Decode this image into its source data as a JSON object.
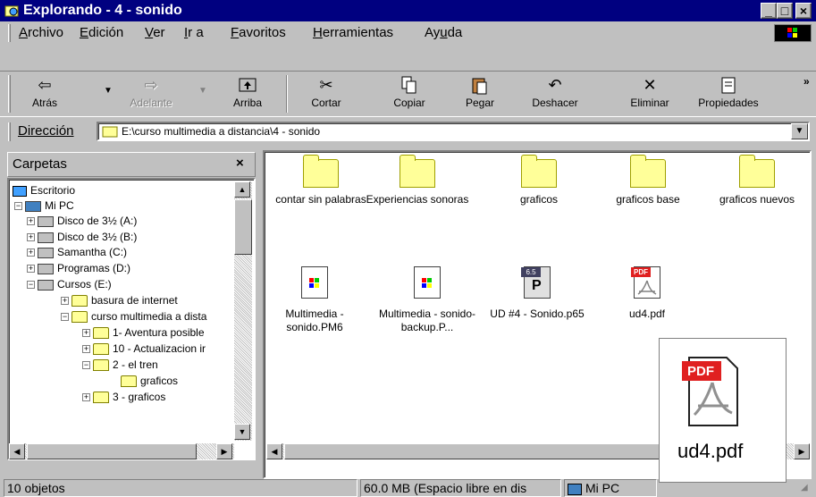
{
  "window": {
    "title": "Explorando - 4 - sonido",
    "btn_min": "_",
    "btn_max": "□",
    "btn_close": "×"
  },
  "menu": {
    "items": [
      {
        "pre": "",
        "u": "A",
        "post": "rchivo"
      },
      {
        "pre": "",
        "u": "E",
        "post": "dición"
      },
      {
        "pre": "",
        "u": "V",
        "post": "er"
      },
      {
        "pre": "",
        "u": "I",
        "post": "r a"
      },
      {
        "pre": "",
        "u": "F",
        "post": "avoritos"
      },
      {
        "pre": "",
        "u": "H",
        "post": "erramientas"
      },
      {
        "pre": "Ay",
        "u": "u",
        "post": "da"
      }
    ]
  },
  "toolbar": {
    "back": "Atrás",
    "forward": "Adelante",
    "up": "Arriba",
    "cut": "Cortar",
    "copy": "Copiar",
    "paste": "Pegar",
    "undo": "Deshacer",
    "delete": "Eliminar",
    "properties": "Propiedades",
    "more": "»"
  },
  "address": {
    "label": "Dirección",
    "value": "E:\\curso multimedia a distancia\\4 - sonido"
  },
  "folders_pane": {
    "title": "Carpetas",
    "close": "×",
    "tree": [
      {
        "label": "Escritorio"
      },
      {
        "label": "Mi PC"
      },
      {
        "label": "Disco de 3½ (A:)"
      },
      {
        "label": "Disco de 3½ (B:)"
      },
      {
        "label": "Samantha (C:)"
      },
      {
        "label": "Programas (D:)"
      },
      {
        "label": "Cursos (E:)"
      },
      {
        "label": "basura de internet"
      },
      {
        "label": "curso multimedia a dista"
      },
      {
        "label": "1- Aventura posible"
      },
      {
        "label": "10 - Actualizacion ir"
      },
      {
        "label": "2 - el tren"
      },
      {
        "label": "graficos"
      },
      {
        "label": "3 - graficos"
      }
    ]
  },
  "files": [
    {
      "name": "contar sin palabras",
      "type": "folder"
    },
    {
      "name": "Experiencias sonoras",
      "type": "folder"
    },
    {
      "name": "graficos",
      "type": "folder"
    },
    {
      "name": "graficos base",
      "type": "folder"
    },
    {
      "name": "graficos nuevos",
      "type": "folder"
    },
    {
      "name": "Multimedia - sonido.PM6",
      "type": "pm6"
    },
    {
      "name": "Multimedia - sonido-backup.P...",
      "type": "pm6"
    },
    {
      "name": "UD #4 - Sonido.p65",
      "type": "p65"
    },
    {
      "name": "ud4.pdf",
      "type": "pdf"
    }
  ],
  "file_icon_badges": {
    "p65": "6.5",
    "pdf": "PDF"
  },
  "tooltip": {
    "name": "ud4.pdf",
    "badge": "PDF"
  },
  "status": {
    "count": "10 objetos",
    "space": "60.0 MB (Espacio libre en dis",
    "location": "Mi PC"
  },
  "colors": {
    "titlebar": "#000080",
    "face": "#c0c0c0",
    "folder": "#ffff99",
    "pdf_red": "#e02020"
  }
}
